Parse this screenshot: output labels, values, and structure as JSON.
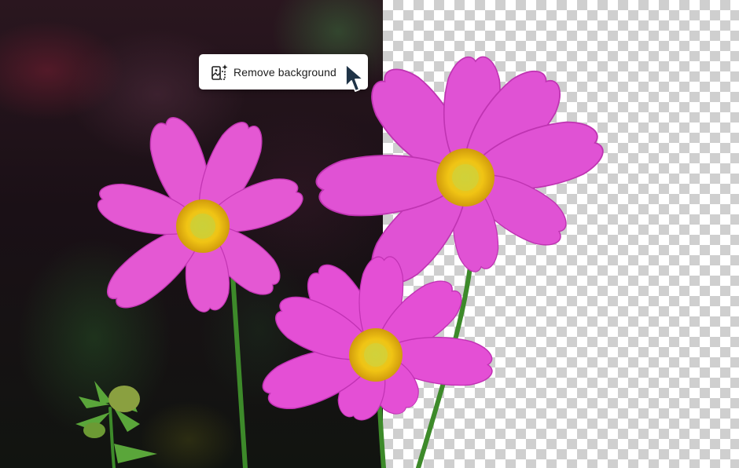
{
  "action_button": {
    "label": "Remove background",
    "icon": "image-sparkle-icon"
  },
  "pointer": {
    "icon": "mouse-pointer-icon"
  },
  "colors": {
    "petal": "#e64fd3",
    "petal_dark": "#b82aa8",
    "flower_center": "#f1c20f",
    "stem": "#3d8a2a",
    "checker_dark": "#cfcfcf",
    "checker_light": "#ffffff",
    "cursor": "#1f3346"
  }
}
